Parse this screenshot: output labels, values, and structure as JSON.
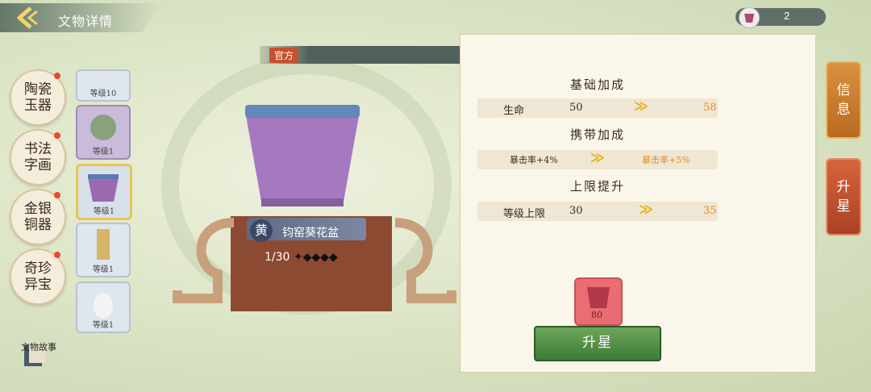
{
  "header": {
    "title": "文物详情",
    "currency": "2"
  },
  "categories": [
    {
      "label": "陶瓷\n玉器",
      "has_dot": true
    },
    {
      "label": "书法\n字画",
      "has_dot": true
    },
    {
      "label": "金银\n铜器",
      "has_dot": true
    },
    {
      "label": "奇珍\n异宝",
      "has_dot": true
    }
  ],
  "relics": [
    {
      "level": "等级10"
    },
    {
      "level": "等级1"
    },
    {
      "level": "等级1",
      "selected": true
    },
    {
      "level": "等级1"
    },
    {
      "level": "等级1"
    }
  ],
  "stage": {
    "official_tag": "官方",
    "bar_stars": "◆◆◆◆ ≫ ◆◆◆◆◆",
    "grade": "黄",
    "name": "钧窑葵花盆",
    "progress": "1/30",
    "stars": "✦◆◆◆◆"
  },
  "panel": {
    "basic_title": "基础加成",
    "basic": {
      "label": "生命",
      "from": "50",
      "to": "58"
    },
    "carry_title": "携带加成",
    "carry": {
      "from": "暴击率+4%",
      "to": "暴击率+5%"
    },
    "limit_title": "上限提升",
    "limit": {
      "label": "等级上限",
      "from": "30",
      "to": "35"
    },
    "cost": "80",
    "upgrade_label": "升星"
  },
  "tabs": {
    "info": "信\n息",
    "star": "升\n星"
  },
  "story_label": "文物故事",
  "colors": {
    "accent_gold": "#e6b21f",
    "upgrade_orange": "#e68a2a",
    "button_green": "#4f8a43"
  }
}
